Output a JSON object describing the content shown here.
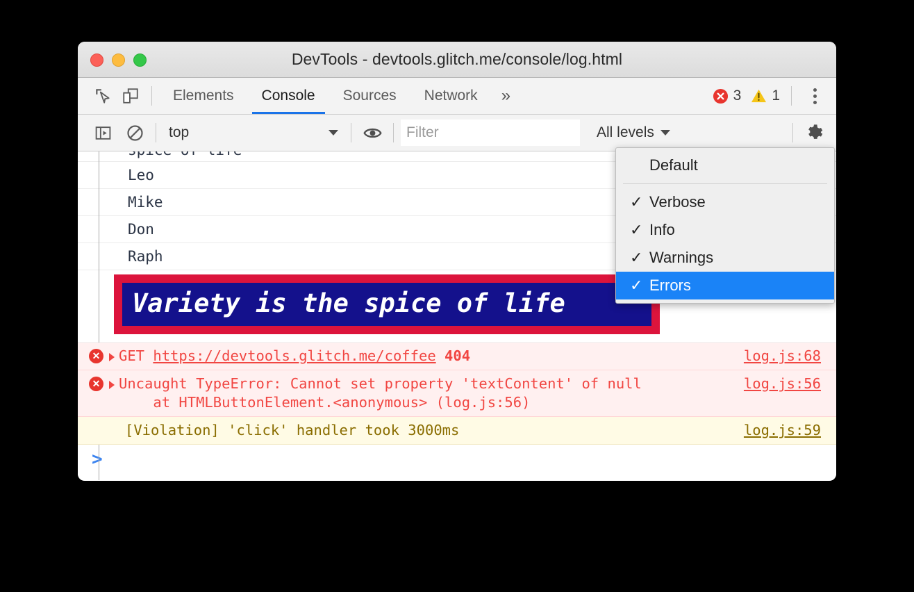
{
  "window": {
    "title": "DevTools - devtools.glitch.me/console/log.html",
    "traffic_lights": [
      {
        "name": "close",
        "color": "#fc6058"
      },
      {
        "name": "minimize",
        "color": "#fdbc40"
      },
      {
        "name": "zoom",
        "color": "#34c749"
      }
    ]
  },
  "tabbar": {
    "inspect_icon": "inspect-element-icon",
    "device_icon": "device-toolbar-icon",
    "tabs": [
      {
        "label": "Elements",
        "active": false
      },
      {
        "label": "Console",
        "active": true
      },
      {
        "label": "Sources",
        "active": false
      },
      {
        "label": "Network",
        "active": false
      }
    ],
    "more_tabs_label": "»",
    "error_count": "3",
    "warning_count": "1",
    "menu_icon": "kebab-menu-icon"
  },
  "console_toolbar": {
    "sidebar_icon": "console-sidebar-icon",
    "clear_icon": "clear-console-icon",
    "context": "top",
    "eye_icon": "live-expression-eye-icon",
    "filter_placeholder": "Filter",
    "filter_value": "",
    "levels_label": "All levels",
    "settings_icon": "settings-gear-icon"
  },
  "levels_dropdown": {
    "items": [
      {
        "label": "Default",
        "checked": false,
        "selected": false,
        "separator_after": true
      },
      {
        "label": "Verbose",
        "checked": true,
        "selected": false,
        "separator_after": false
      },
      {
        "label": "Info",
        "checked": true,
        "selected": false,
        "separator_after": false
      },
      {
        "label": "Warnings",
        "checked": true,
        "selected": false,
        "separator_after": false
      },
      {
        "label": "Errors",
        "checked": true,
        "selected": true,
        "separator_after": false
      }
    ],
    "check_glyph": "✓"
  },
  "console": {
    "clipped_message": "spice of life",
    "group_items": [
      "Leo",
      "Mike",
      "Don",
      "Raph"
    ],
    "banner": {
      "text": "Variety is the spice of life",
      "border_color": "#dc143c",
      "background_color": "#14118c",
      "text_color": "#ffffff"
    },
    "messages": [
      {
        "level": "error",
        "method": "GET",
        "url": "https://devtools.glitch.me/coffee",
        "status": "404",
        "source": "log.js:68"
      },
      {
        "level": "error",
        "text": "Uncaught TypeError: Cannot set property 'textContent' of null",
        "stack": "    at HTMLButtonElement.<anonymous> (log.js:56)",
        "source": "log.js:56"
      },
      {
        "level": "warning",
        "text": "[Violation] 'click' handler took 3000ms",
        "source": "log.js:59"
      }
    ],
    "prompt_glyph": ">"
  },
  "colors": {
    "accent_blue": "#1a73e8",
    "selection_blue": "#1a83f7",
    "error_red": "#e8352e",
    "error_text": "#f14642",
    "error_bg": "#fff0f0",
    "warning_yellow": "#f5c518",
    "warning_bg": "#fffbe5",
    "warning_text": "#8a6d00",
    "prompt_blue": "#3c84f0"
  }
}
